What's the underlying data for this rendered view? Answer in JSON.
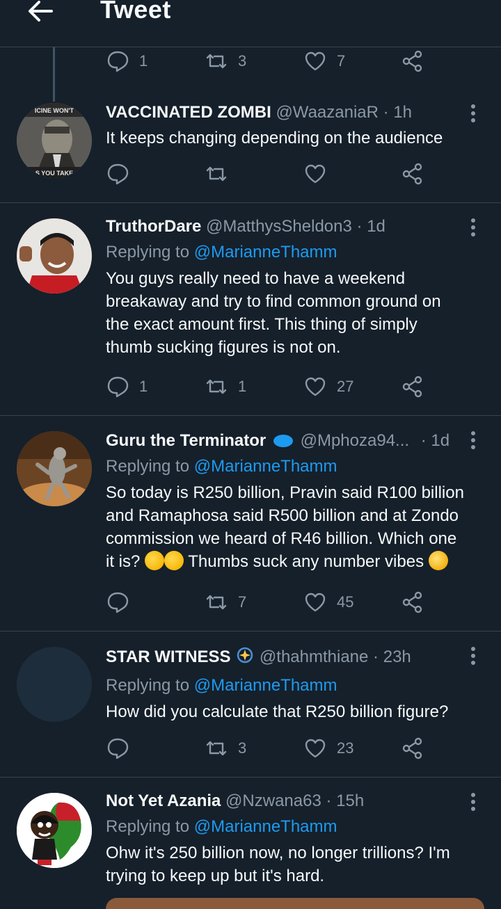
{
  "header": {
    "title": "Tweet"
  },
  "colors": {
    "background": "#15202b",
    "divider": "#38444d",
    "secondary_text": "#8b98a5",
    "accent": "#1d9bf0"
  },
  "parent_actions": {
    "replies": "1",
    "retweets": "3",
    "likes": "7"
  },
  "tweets": [
    {
      "name": "VACCINATED ZOMBI",
      "handle": "@WaazaniaR",
      "dot": "·",
      "time": "1h",
      "text": "It keeps changing depending on the audience",
      "replies": "",
      "retweets": "",
      "likes": "",
      "avatar_top_text": "ICINE WON'T",
      "avatar_bottom_text": "S YOU TAKE"
    },
    {
      "name": "TruthorDare",
      "handle": "@MatthysSheldon3",
      "dot": "·",
      "time": "1d",
      "replying_label": "Replying to",
      "mention": "@MarianneThamm",
      "text": "You guys really need to have a weekend breakaway and  try to find common ground on the exact amount first. This thing of simply thumb sucking figures is not on.",
      "replies": "1",
      "retweets": "1",
      "likes": "27"
    },
    {
      "name": "Guru the Terminator",
      "handle": "@Mphoza94...",
      "dot": "·",
      "time": "1d",
      "replying_label": "Replying to",
      "mention": "@MarianneThamm",
      "text": "So today is R250 billion, Pravin said R100 billion and Ramaphosa said R500 billion and at Zondo commission we heard of R46 billion. Which one it is?",
      "text_after": "Thumbs suck any number vibes",
      "replies": "",
      "retweets": "7",
      "likes": "45"
    },
    {
      "name": "STAR WITNESS",
      "handle": "@thahmthiane",
      "dot": "·",
      "time": "23h",
      "replying_label": "Replying to",
      "mention": "@MarianneThamm",
      "text": "How did you calculate that R250 billion figure?",
      "replies": "",
      "retweets": "3",
      "likes": "23"
    },
    {
      "name": "Not Yet Azania",
      "handle": "@Nzwana63",
      "dot": "·",
      "time": "15h",
      "replying_label": "Replying to",
      "mention": "@MarianneThamm",
      "text": "Ohw it's 250 billion now, no longer trillions? I'm trying to keep up but it's hard."
    }
  ]
}
